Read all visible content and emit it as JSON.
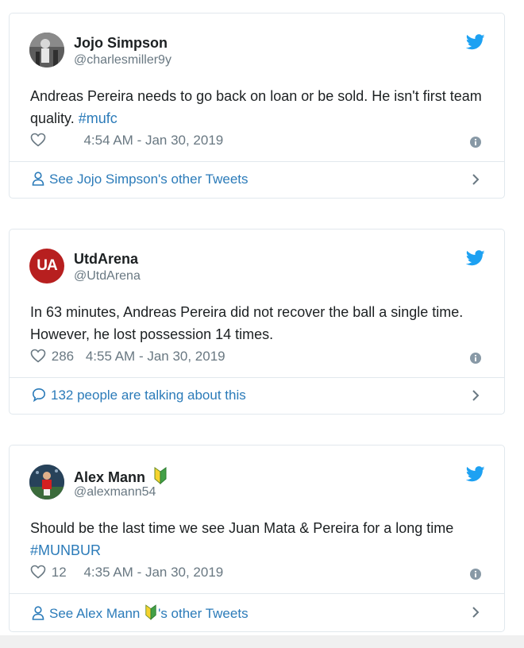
{
  "tweets": [
    {
      "name": "Jojo Simpson",
      "handle": "@charlesmiller9y",
      "text_main": "Andreas Pereira needs to go back on loan or be sold. He isn't first team quality. ",
      "hashtag": "#mufc",
      "likes": "",
      "time": "4:54 AM - Jan 30, 2019",
      "footer_pre": "See Jojo Simpson's other Tweets",
      "footer_post": "",
      "footer_icon": "person-icon",
      "avatar_icon": "photo-avatar"
    },
    {
      "name": "UtdArena",
      "handle": "@UtdArena",
      "text_main": "In 63 minutes, Andreas Pereira did not recover the ball a single time. However, he lost possession 14 times.",
      "hashtag": "",
      "likes": "286",
      "time": "4:55 AM - Jan 30, 2019",
      "footer_pre": "132 people are talking about this",
      "footer_post": "",
      "footer_icon": "comment-icon",
      "avatar_text": "UA",
      "avatar_color": "#b71f1f"
    },
    {
      "name": "Alex Mann",
      "handle": "@alexmann54",
      "text_main": "Should be the last time we see Juan Mata & Pereira for a long time ",
      "hashtag": "#MUNBUR",
      "likes": "12",
      "time": "4:35 AM - Jan 30, 2019",
      "footer_pre": "See Alex Mann ",
      "footer_post": "'s other Tweets",
      "footer_icon": "person-icon",
      "badge_icon": "beginner-badge-icon"
    }
  ],
  "colors": {
    "link": "#2b7bb9",
    "muted": "#697882",
    "twitter_blue": "#1da1f2",
    "border": "#e1e8ed"
  }
}
